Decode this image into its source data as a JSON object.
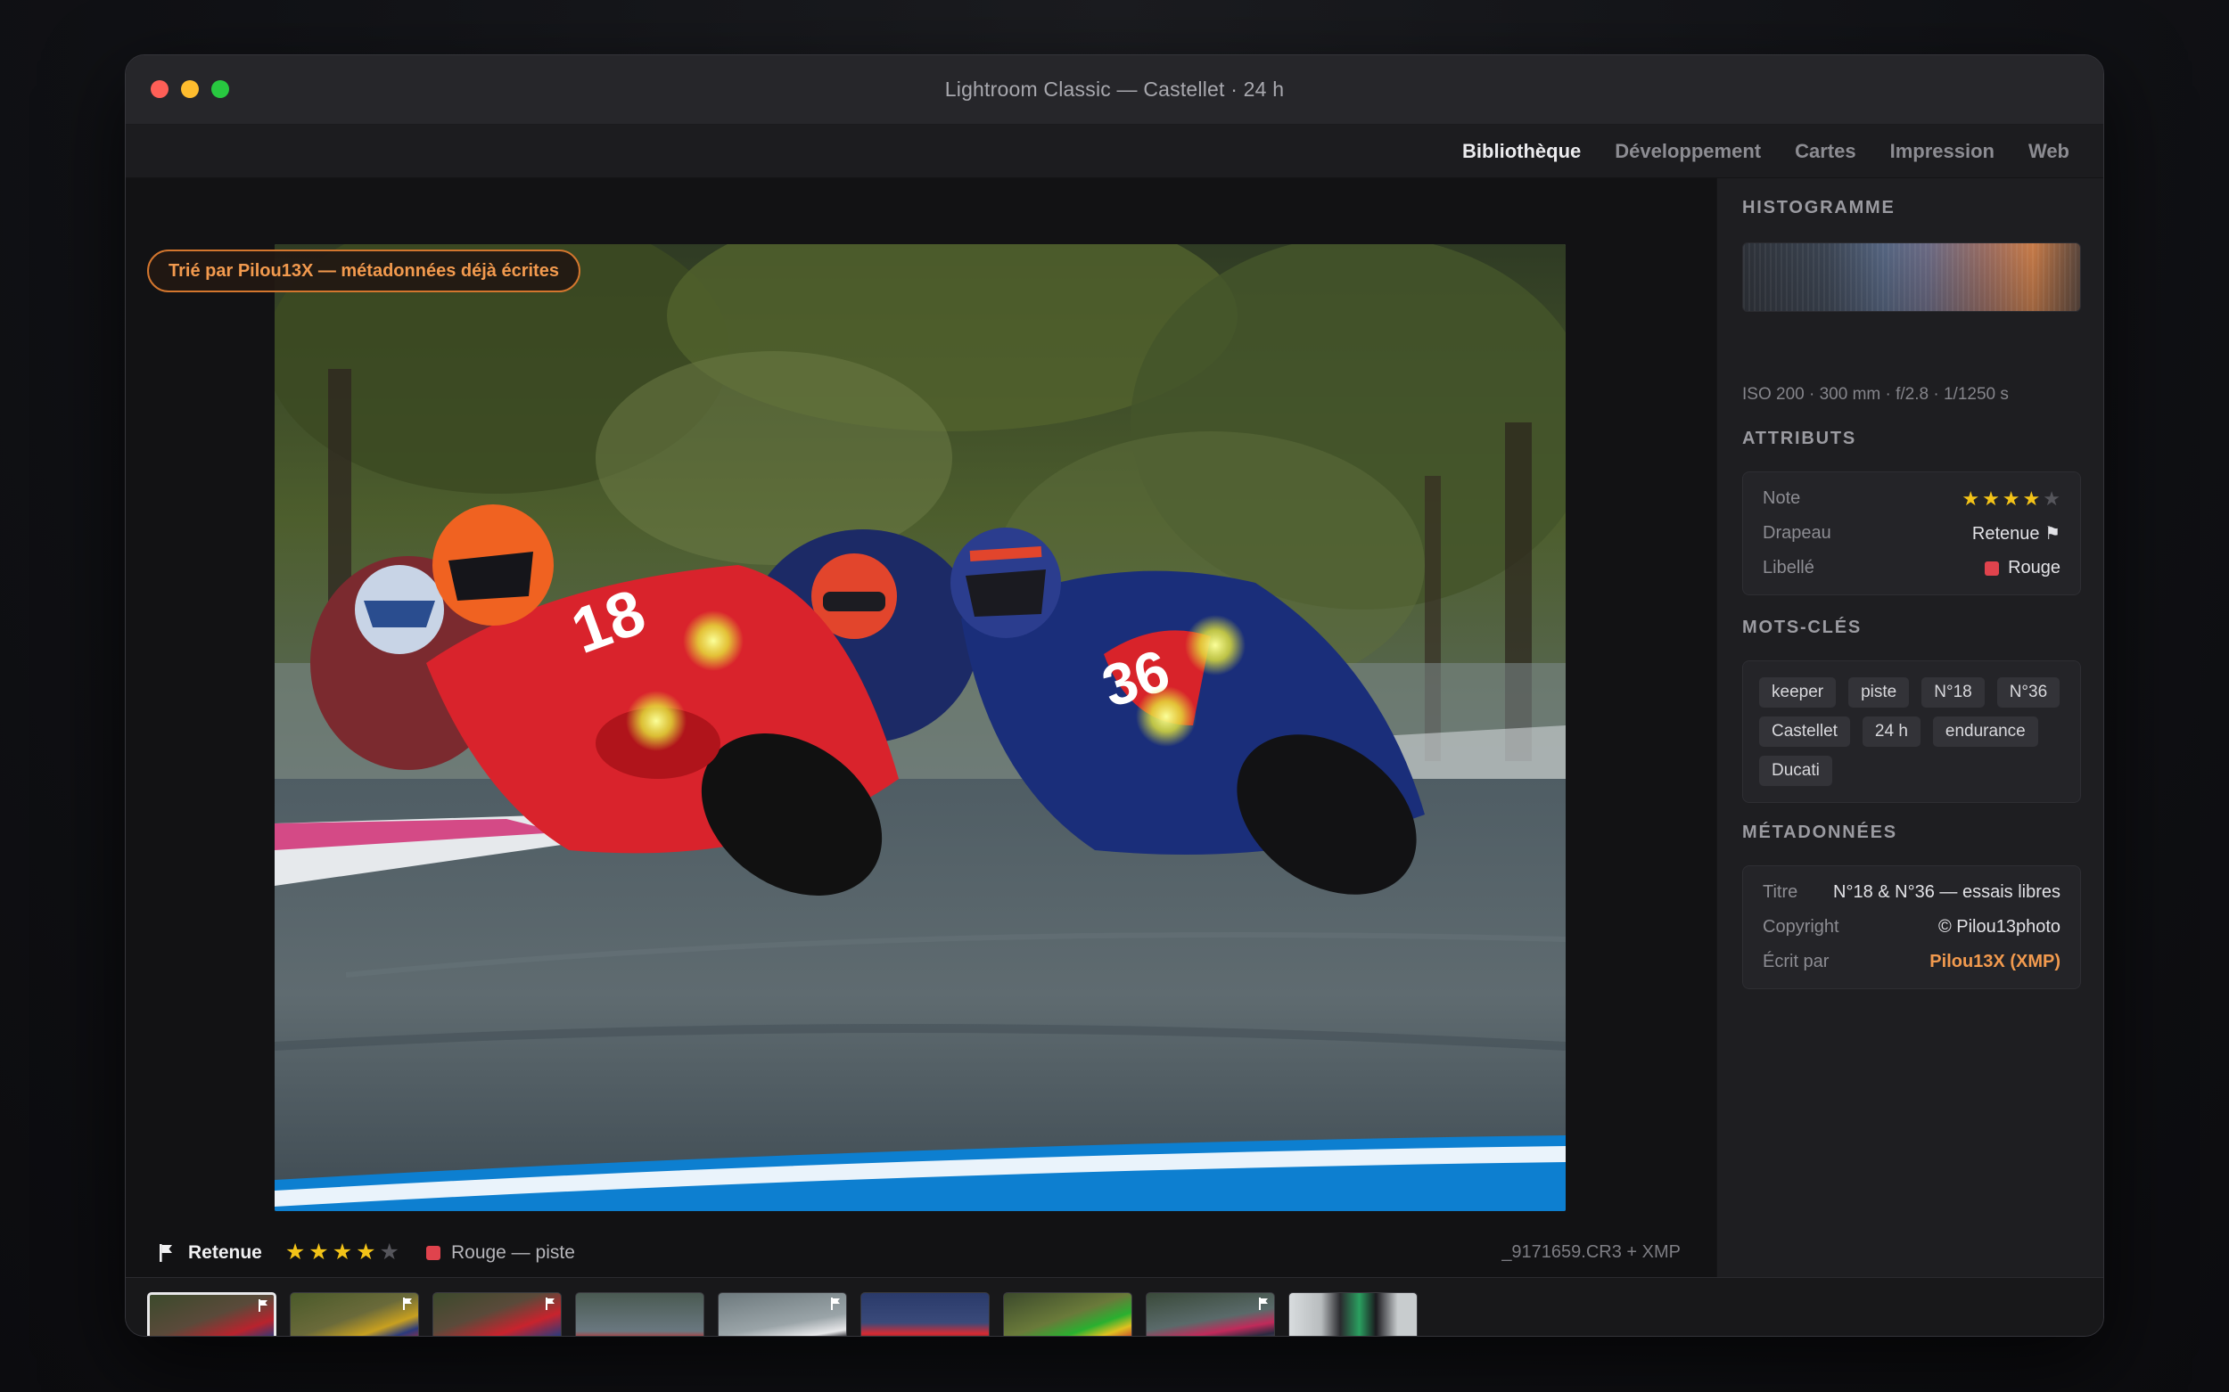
{
  "window": {
    "title": "Lightroom Classic — Castellet · 24 h"
  },
  "modules": [
    {
      "label": "Bibliothèque",
      "active": true
    },
    {
      "label": "Développement"
    },
    {
      "label": "Cartes"
    },
    {
      "label": "Impression"
    },
    {
      "label": "Web"
    }
  ],
  "viewer": {
    "sort_badge": "Trié par Pilou13X — métadonnées déjà écrites",
    "flag_label": "Retenue",
    "rating": 4,
    "color_label": "Rouge — piste",
    "label_color": "#e0434d",
    "filename": "_9171659.CR3 + XMP"
  },
  "panel": {
    "histogram_title": "HISTOGRAMME",
    "exif": "ISO 200 · 300 mm · f/2.8 · 1/1250 s",
    "attributes_title": "ATTRIBUTS",
    "attributes": {
      "note_key": "Note",
      "rating": 4,
      "flag_key": "Drapeau",
      "flag_value": "Retenue ⚑",
      "label_key": "Libellé",
      "label_value": "Rouge"
    },
    "keywords_title": "MOTS-CLÉS",
    "keywords": [
      "keeper",
      "piste",
      "N°18",
      "N°36",
      "Castellet",
      "24 h",
      "endurance",
      "Ducati"
    ],
    "metadata_title": "MÉTADONNÉES",
    "metadata": {
      "title_key": "Titre",
      "title_value": "N°18 & N°36 — essais libres",
      "copyright_key": "Copyright",
      "copyright_value": "© Pilou13photo",
      "written_key": "Écrit par",
      "written_value": "Pilou13X (XMP)"
    }
  },
  "filmstrip": [
    {
      "stars": "★★★★",
      "flag": true,
      "selected": true
    },
    {
      "stars": "★★★★",
      "flag": true
    },
    {
      "stars": "★★★",
      "flag": true
    },
    {
      "stars": "★★★",
      "flag": false
    },
    {
      "stars": "★★★★",
      "flag": true
    },
    {
      "stars": "★★",
      "flag": false
    },
    {
      "stars": "★★★",
      "flag": false
    },
    {
      "stars": "★★★★",
      "flag": true
    },
    {
      "stars": "★★★",
      "flag": false
    }
  ],
  "accent_color": "#f29a4e",
  "star_color": "#f3c318"
}
